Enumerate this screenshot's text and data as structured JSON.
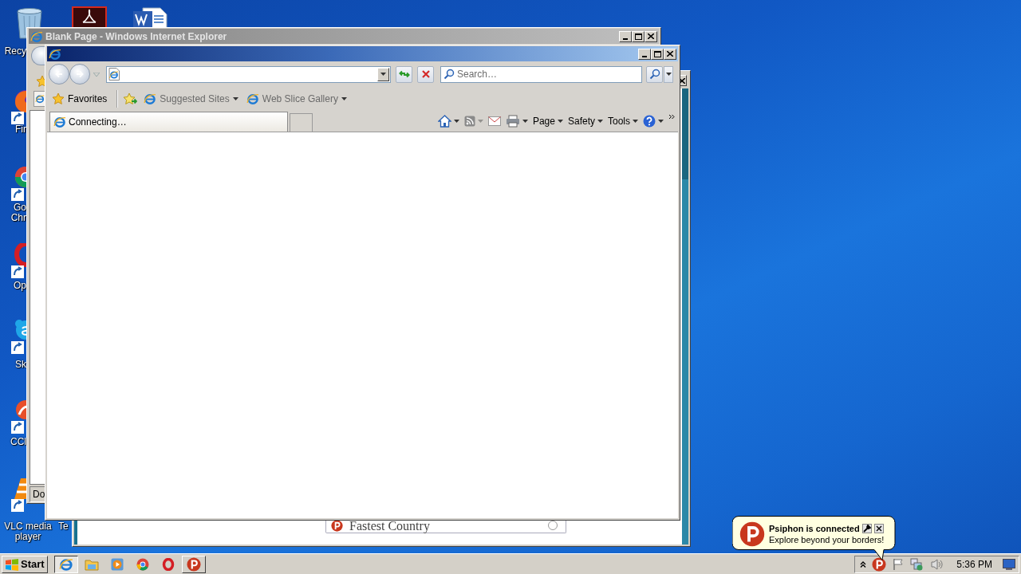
{
  "desktop_icons": [
    {
      "kind": "trash",
      "label": "Recy"
    },
    {
      "kind": "pdf"
    },
    {
      "kind": "document"
    },
    {
      "kind": "fox",
      "label": "Fir"
    },
    {
      "kind": "wheel",
      "label": "Go Chr"
    },
    {
      "kind": "ring",
      "label": "Op"
    },
    {
      "kind": "cloud",
      "label": "Sk"
    },
    {
      "kind": "brush",
      "label": "CCl"
    },
    {
      "kind": "cone",
      "label": "VLC media player"
    },
    {
      "label": "Te"
    }
  ],
  "psiphon_window": {
    "button_label": "Fastest Country",
    "selected": false
  },
  "background_browser": {
    "title": "Blank Page - Windows Internet Explorer",
    "status": "Do"
  },
  "browser": {
    "search_placeholder": "Search…",
    "favorites_bar": [
      {
        "kind": "favorites",
        "label": "Favorites"
      },
      {
        "kind": "link",
        "label": "Suggested Sites"
      },
      {
        "kind": "link",
        "label": "Web Slice Gallery"
      }
    ],
    "tabs": [
      {
        "label": "Connecting…",
        "selected": true
      }
    ],
    "command_bar": [
      {
        "label": "Page"
      },
      {
        "label": "Safety"
      },
      {
        "label": "Tools"
      }
    ]
  },
  "taskbar": {
    "start_label": "Start",
    "apps": [
      {
        "kind": "browser",
        "selected": true
      },
      {
        "kind": "folder",
        "selected": false
      },
      {
        "kind": "player",
        "selected": false
      },
      {
        "kind": "wheel",
        "selected": false
      },
      {
        "kind": "ring",
        "selected": false
      },
      {
        "kind": "psiphon",
        "selected": false
      }
    ],
    "clock": "5:36 PM"
  },
  "notification": {
    "title": "Psiphon is connected",
    "message": "Explore beyond your borders!"
  }
}
